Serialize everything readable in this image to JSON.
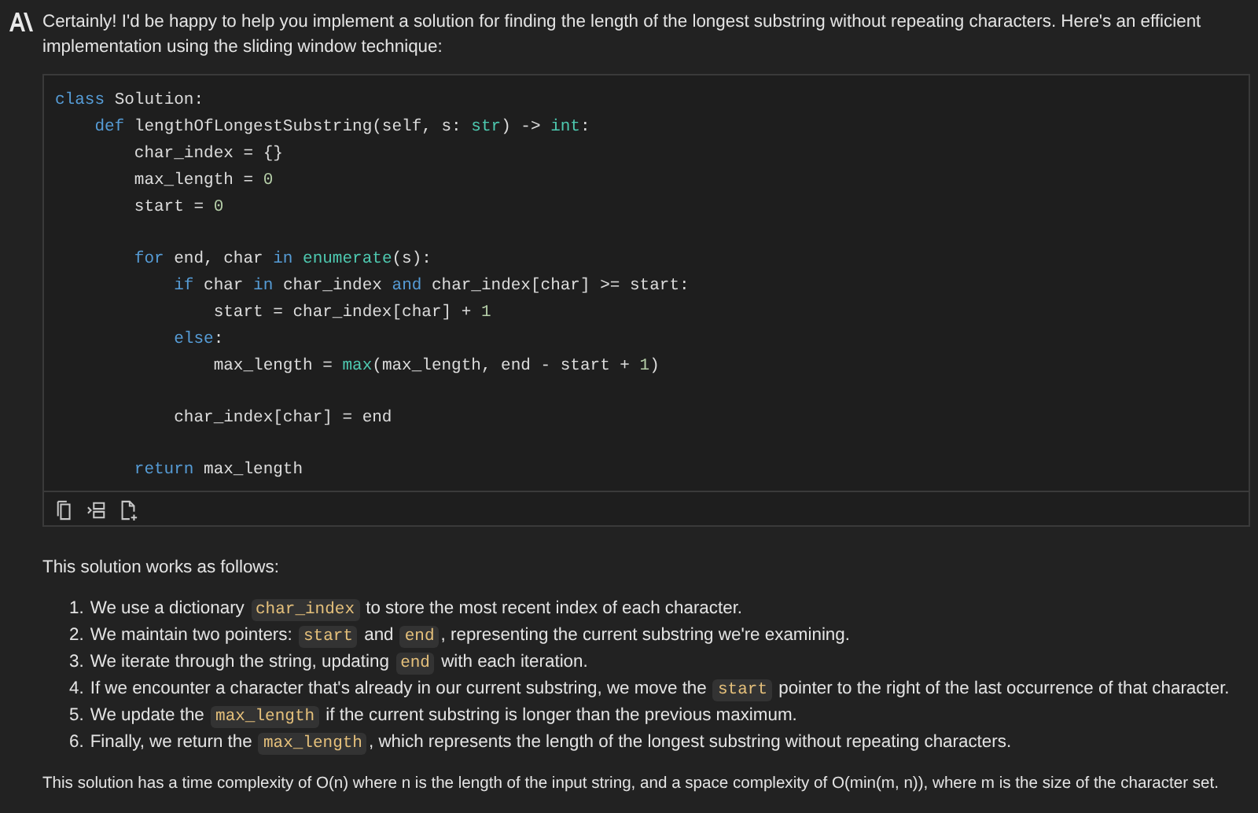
{
  "message": {
    "intro": "Certainly! I'd be happy to help you implement a solution for finding the length of the longest substring without repeating characters. Here's an efficient implementation using the sliding window technique:",
    "code_block": {
      "lines": [
        {
          "kind": "code",
          "tokens": [
            {
              "kind": "keyword",
              "text": "class"
            },
            {
              "kind": "plain",
              "text": " Solution:"
            }
          ]
        },
        {
          "kind": "code",
          "tokens": [
            {
              "kind": "keyword",
              "text": "    def"
            },
            {
              "kind": "plain",
              "text": " lengthOfLongestSubstring(self, s: "
            },
            {
              "kind": "builtin",
              "text": "str"
            },
            {
              "kind": "plain",
              "text": ") -> "
            },
            {
              "kind": "builtin",
              "text": "int"
            },
            {
              "kind": "plain",
              "text": ":"
            }
          ]
        },
        {
          "kind": "code",
          "tokens": [
            {
              "kind": "plain",
              "text": "        char_index = {}"
            }
          ]
        },
        {
          "kind": "code",
          "tokens": [
            {
              "kind": "plain",
              "text": "        max_length = "
            },
            {
              "kind": "number",
              "text": "0"
            }
          ]
        },
        {
          "kind": "code",
          "tokens": [
            {
              "kind": "plain",
              "text": "        start = "
            },
            {
              "kind": "number",
              "text": "0"
            }
          ]
        },
        {
          "kind": "blank"
        },
        {
          "kind": "code",
          "tokens": [
            {
              "kind": "keyword",
              "text": "        for"
            },
            {
              "kind": "plain",
              "text": " end, char "
            },
            {
              "kind": "keyword",
              "text": "in "
            },
            {
              "kind": "builtin",
              "text": "enumerate"
            },
            {
              "kind": "plain",
              "text": "(s):"
            }
          ]
        },
        {
          "kind": "code",
          "tokens": [
            {
              "kind": "keyword",
              "text": "            if"
            },
            {
              "kind": "plain",
              "text": " char "
            },
            {
              "kind": "keyword",
              "text": "in"
            },
            {
              "kind": "plain",
              "text": " char_index "
            },
            {
              "kind": "keyword",
              "text": "and"
            },
            {
              "kind": "plain",
              "text": " char_index[char] >= start:"
            }
          ]
        },
        {
          "kind": "code",
          "tokens": [
            {
              "kind": "plain",
              "text": "                start = char_index[char] + "
            },
            {
              "kind": "number",
              "text": "1"
            }
          ]
        },
        {
          "kind": "code",
          "tokens": [
            {
              "kind": "keyword",
              "text": "            else"
            },
            {
              "kind": "plain",
              "text": ":"
            }
          ]
        },
        {
          "kind": "code",
          "tokens": [
            {
              "kind": "plain",
              "text": "                max_length = "
            },
            {
              "kind": "builtin",
              "text": "max"
            },
            {
              "kind": "plain",
              "text": "(max_length, end - start + "
            },
            {
              "kind": "number",
              "text": "1"
            },
            {
              "kind": "plain",
              "text": ")"
            }
          ]
        },
        {
          "kind": "blank"
        },
        {
          "kind": "code",
          "tokens": [
            {
              "kind": "plain",
              "text": "            char_index[char] = end"
            }
          ]
        },
        {
          "kind": "blank"
        },
        {
          "kind": "code",
          "tokens": [
            {
              "kind": "keyword",
              "text": "        return"
            },
            {
              "kind": "plain",
              "text": " max_length"
            }
          ]
        }
      ]
    },
    "explanation_heading": "This solution works as follows:",
    "steps": [
      {
        "number": "1.",
        "parts": [
          {
            "kind": "text",
            "text": "We use a dictionary "
          },
          {
            "kind": "code",
            "text": "char_index"
          },
          {
            "kind": "text",
            "text": " to store the most recent index of each character."
          }
        ]
      },
      {
        "number": "2.",
        "parts": [
          {
            "kind": "text",
            "text": "We maintain two pointers: "
          },
          {
            "kind": "code",
            "text": "start"
          },
          {
            "kind": "text",
            "text": " and "
          },
          {
            "kind": "code",
            "text": "end"
          },
          {
            "kind": "text",
            "text": ", representing the current substring we're examining."
          }
        ]
      },
      {
        "number": "3.",
        "parts": [
          {
            "kind": "text",
            "text": "We iterate through the string, updating "
          },
          {
            "kind": "code",
            "text": "end"
          },
          {
            "kind": "text",
            "text": " with each iteration."
          }
        ]
      },
      {
        "number": "4.",
        "parts": [
          {
            "kind": "text",
            "text": "If we encounter a character that's already in our current substring, we move the "
          },
          {
            "kind": "code",
            "text": "start"
          },
          {
            "kind": "text",
            "text": " pointer to the right of the last occurrence of that character."
          }
        ]
      },
      {
        "number": "5.",
        "parts": [
          {
            "kind": "text",
            "text": "We update the "
          },
          {
            "kind": "code",
            "text": "max_length"
          },
          {
            "kind": "text",
            "text": " if the current substring is longer than the previous maximum."
          }
        ]
      },
      {
        "number": "6.",
        "parts": [
          {
            "kind": "text",
            "text": "Finally, we return the "
          },
          {
            "kind": "code",
            "text": "max_length"
          },
          {
            "kind": "text",
            "text": ", which represents the length of the longest substring without repeating characters."
          }
        ]
      }
    ],
    "conclusion": "This solution has a time complexity of O(n) where n is the length of the input string, and a space complexity of O(min(m, n)), where m is the size of the character set."
  }
}
